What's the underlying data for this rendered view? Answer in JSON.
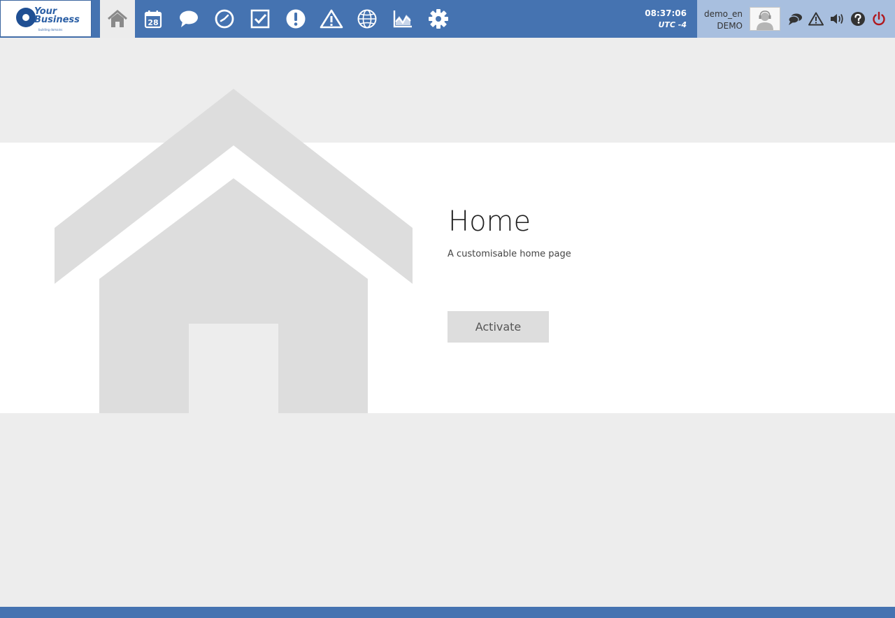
{
  "brand": {
    "logo_line1": "Your",
    "logo_line2": "Business",
    "logo_tagline": "building domains"
  },
  "nav": {
    "items": [
      {
        "icon": "home-icon",
        "active": true
      },
      {
        "icon": "calendar-icon",
        "label": "28"
      },
      {
        "icon": "chat-bubble-icon"
      },
      {
        "icon": "clock-icon"
      },
      {
        "icon": "checkbox-icon"
      },
      {
        "icon": "exclamation-circle-icon"
      },
      {
        "icon": "warning-triangle-icon"
      },
      {
        "icon": "globe-icon"
      },
      {
        "icon": "chart-icon"
      },
      {
        "icon": "gear-icon"
      }
    ]
  },
  "clock": {
    "time": "08:37:06",
    "timezone": "UTC -4"
  },
  "user": {
    "name": "demo_en",
    "org": "DEMO"
  },
  "tools": [
    "chat-icon",
    "warning-icon",
    "speaker-icon",
    "help-icon",
    "power-icon"
  ],
  "page": {
    "title": "Home",
    "subtitle": "A customisable home page",
    "activate_label": "Activate"
  },
  "colors": {
    "topbar": "#4573b1",
    "user_panel": "#a8bfdf",
    "page_bg": "#ededed",
    "house_grey": "#dddddd",
    "power_red": "#b0181e"
  }
}
